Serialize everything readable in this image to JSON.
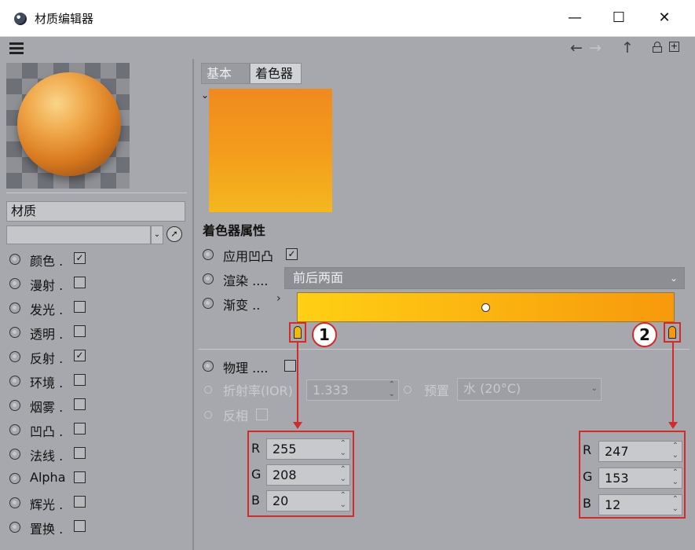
{
  "window": {
    "title": "材质编辑器",
    "minimize": "—",
    "maximize": "☐",
    "close": "✕"
  },
  "toolbar": {
    "back_arrow": "←",
    "forward_arrow": "→",
    "up_arrow": "↑"
  },
  "left": {
    "material_name": "材质",
    "channels": [
      {
        "label": "颜色",
        "dots": ".",
        "checked": true
      },
      {
        "label": "漫射",
        "dots": ".",
        "checked": false
      },
      {
        "label": "发光",
        "dots": ".",
        "checked": false
      },
      {
        "label": "透明",
        "dots": ".",
        "checked": false
      },
      {
        "label": "反射",
        "dots": ".",
        "checked": true
      },
      {
        "label": "环境",
        "dots": ".",
        "checked": false
      },
      {
        "label": "烟雾",
        "dots": ".",
        "checked": false
      },
      {
        "label": "凹凸",
        "dots": ".",
        "checked": false
      },
      {
        "label": "法线",
        "dots": ".",
        "checked": false
      },
      {
        "label": "Alpha",
        "dots": "",
        "checked": false
      },
      {
        "label": "辉光",
        "dots": ".",
        "checked": false
      },
      {
        "label": "置换",
        "dots": ".",
        "checked": false
      }
    ]
  },
  "tabs": [
    {
      "label": "基本"
    },
    {
      "label": "着色器"
    }
  ],
  "shader": {
    "section_title": "着色器属性",
    "apply_bump_label": "应用凹凸",
    "render_label": "渲染",
    "render_dots": "....",
    "render_value": "前后两面",
    "gradient_label": "渐变",
    "gradient_dots": "..",
    "gradient_colors": [
      "#ffd014",
      "#f7990c"
    ],
    "physical_label": "物理",
    "physical_dots": "....",
    "ior_label": "折射率(IOR)",
    "ior_value": "1.333",
    "preset_label": "预置",
    "preset_value": "水 (20°C)",
    "invert_label": "反相"
  },
  "annotations": {
    "marker1": "1",
    "marker2": "2",
    "stop1": {
      "r_label": "R",
      "g_label": "G",
      "b_label": "B",
      "r": "255",
      "g": "208",
      "b": "20"
    },
    "stop2": {
      "r_label": "R",
      "g_label": "G",
      "b_label": "B",
      "r": "247",
      "g": "153",
      "b": "12"
    }
  }
}
